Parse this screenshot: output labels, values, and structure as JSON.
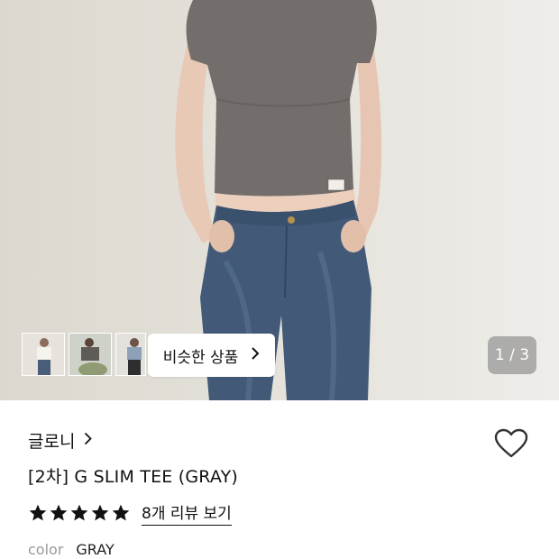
{
  "gallery": {
    "similar_button_label": "비슷한 상품",
    "pager": "1 / 3",
    "thumbnails": [
      "thumbnail-1",
      "thumbnail-2",
      "thumbnail-3"
    ]
  },
  "product": {
    "brand": "글로니",
    "title": "[2차] G SLIM TEE (GRAY)",
    "rating_stars": 5,
    "review_link": "8개 리뷰 보기",
    "color_label": "color",
    "color_value": "GRAY"
  },
  "icons": [
    "chevron-right-icon",
    "heart-icon",
    "star-icon"
  ],
  "colors": {
    "text": "#111111",
    "muted": "#999999",
    "tee": "#706b68",
    "denim": "#3f5673"
  }
}
